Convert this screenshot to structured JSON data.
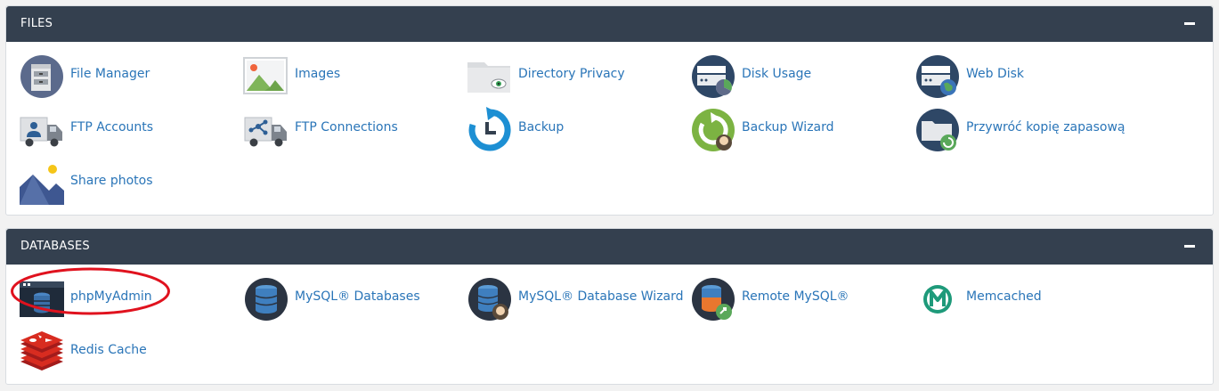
{
  "files": {
    "title": "FILES",
    "items": [
      {
        "label": "File Manager",
        "icon": "file-manager-icon"
      },
      {
        "label": "Images",
        "icon": "images-icon"
      },
      {
        "label": "Directory Privacy",
        "icon": "directory-privacy-icon"
      },
      {
        "label": "Disk Usage",
        "icon": "disk-usage-icon"
      },
      {
        "label": "Web Disk",
        "icon": "web-disk-icon"
      },
      {
        "label": "FTP Accounts",
        "icon": "ftp-accounts-icon"
      },
      {
        "label": "FTP Connections",
        "icon": "ftp-connections-icon"
      },
      {
        "label": "Backup",
        "icon": "backup-icon"
      },
      {
        "label": "Backup Wizard",
        "icon": "backup-wizard-icon"
      },
      {
        "label": "Przywróć kopię zapasową",
        "icon": "restore-backup-icon"
      },
      {
        "label": "Share photos",
        "icon": "share-photos-icon"
      }
    ]
  },
  "databases": {
    "title": "DATABASES",
    "items": [
      {
        "label": "phpMyAdmin",
        "icon": "phpmyadmin-icon"
      },
      {
        "label": "MySQL® Databases",
        "icon": "mysql-databases-icon"
      },
      {
        "label": "MySQL® Database Wizard",
        "icon": "mysql-wizard-icon"
      },
      {
        "label": "Remote MySQL®",
        "icon": "remote-mysql-icon"
      },
      {
        "label": "Memcached",
        "icon": "memcached-icon"
      },
      {
        "label": "Redis Cache",
        "icon": "redis-cache-icon"
      }
    ]
  },
  "colors": {
    "header_bg": "#34404f",
    "link": "#2a75b8",
    "highlight_oval": "#e0121e"
  }
}
